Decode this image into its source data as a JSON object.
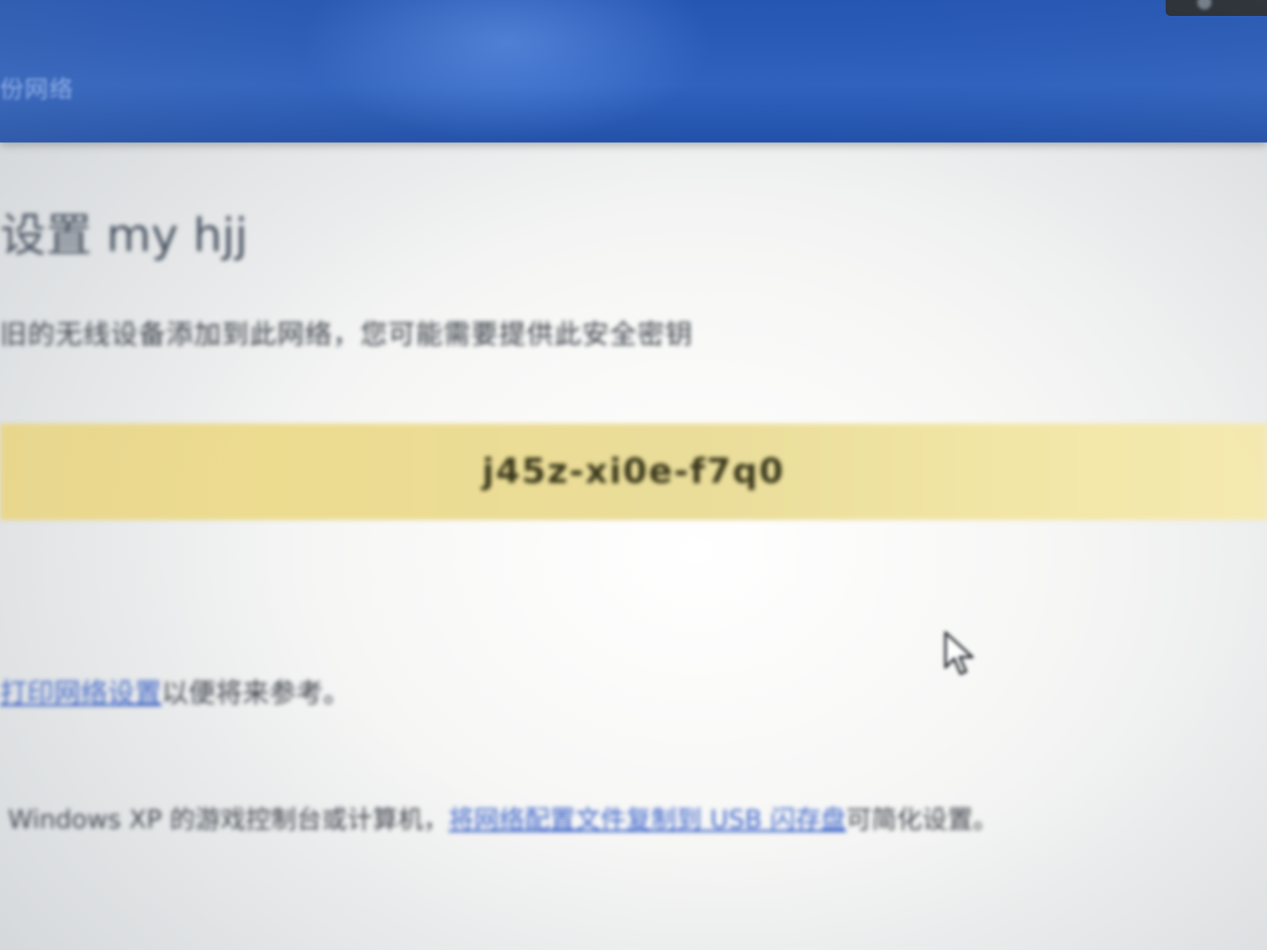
{
  "window": {
    "title": "份网络"
  },
  "dialog": {
    "heading": "设置 my hjj",
    "description": "旧的无线设备添加到此网络，您可能需要提供此安全密钥",
    "security_key": "j45z-xi0e-f7q0",
    "print_link": "打印网络设置",
    "print_suffix": "以便将来参考。",
    "usb_prefix": "Windows XP 的游戏控制台或计算机，",
    "usb_link": "将网络配置文件复制到 USB 闪存盘",
    "usb_suffix": "可简化设置。"
  },
  "colors": {
    "titlebar": "#2256b8",
    "key_band": "#eedb8a",
    "link": "#3b63c9"
  },
  "icons": {
    "pointer": "mouse-pointer-icon"
  }
}
